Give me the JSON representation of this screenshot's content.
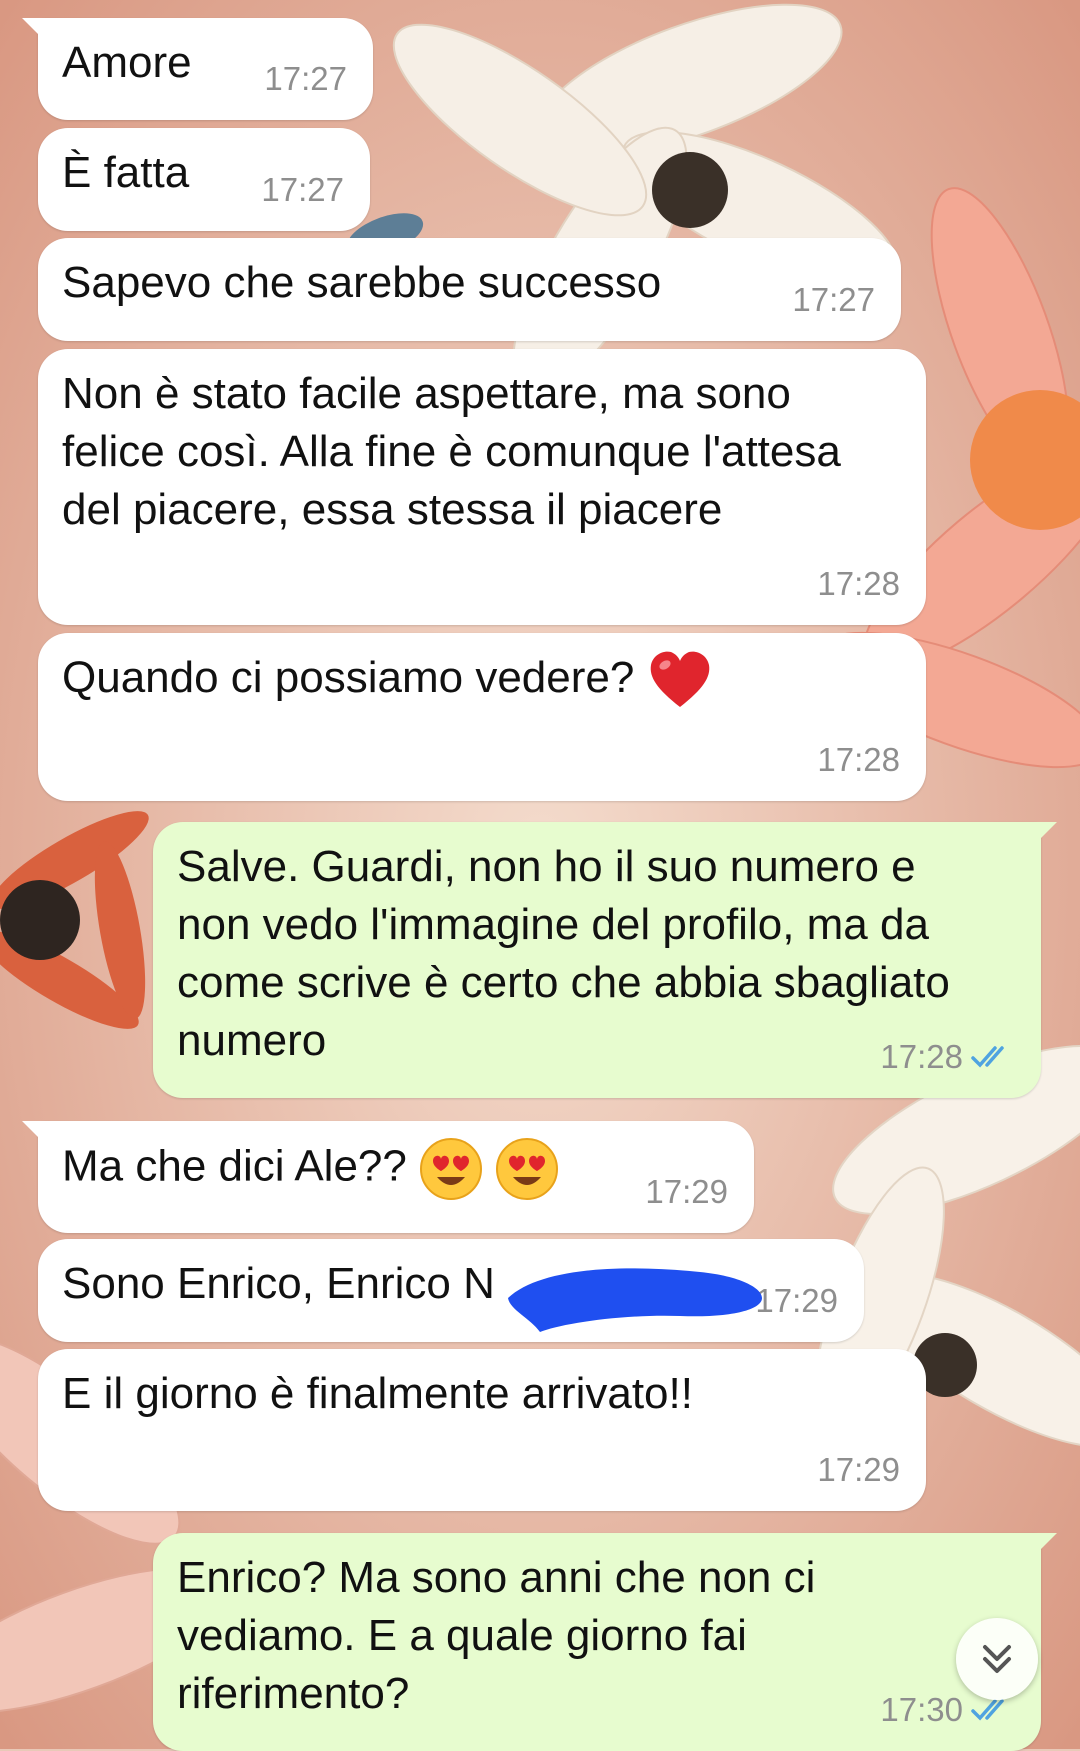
{
  "colors": {
    "incoming_bubble": "#ffffff",
    "outgoing_bubble": "#e7fccf",
    "timestamp": "#8e8e8e",
    "read_ticks": "#4fa3e0",
    "redaction": "#1f4ff0"
  },
  "messages": [
    {
      "direction": "in",
      "text": "Amore",
      "time": "17:27"
    },
    {
      "direction": "in",
      "text": "È fatta",
      "time": "17:27"
    },
    {
      "direction": "in",
      "text": "Sapevo che sarebbe successo",
      "time": "17:27"
    },
    {
      "direction": "in",
      "text": "Non è stato facile aspettare, ma sono felice così. Alla fine è comunque l'attesa del piacere, essa stessa il piacere",
      "time": "17:28"
    },
    {
      "direction": "in",
      "text": "Quando ci possiamo vedere?",
      "emoji": "red-heart",
      "time": "17:28"
    },
    {
      "direction": "out",
      "text": "Salve. Guardi, non ho il suo numero e non vedo l'immagine del profilo, ma da come scrive è certo che abbia sbagliato numero",
      "time": "17:28",
      "status": "read-double-check-icon"
    },
    {
      "direction": "in",
      "text": "Ma che dici Ale??",
      "emoji": "heart-eyes x2",
      "time": "17:29"
    },
    {
      "direction": "in",
      "text": "Sono Enrico, Enrico N",
      "time": "17:29",
      "redacted": true
    },
    {
      "direction": "in",
      "text": "E il giorno è finalmente arrivato!!",
      "time": "17:29"
    },
    {
      "direction": "out",
      "text": "Enrico? Ma sono anni che non ci vediamo. E a quale giorno fai riferimento?",
      "time": "17:30",
      "status": "read-double-check-icon"
    }
  ],
  "scroll_button_icon": "double-chevron-down-icon"
}
